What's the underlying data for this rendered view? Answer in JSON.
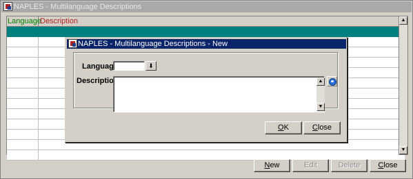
{
  "window": {
    "title": "NAPLES - Multilanguage Descriptions"
  },
  "grid": {
    "columns": [
      "Language",
      "Description"
    ],
    "rows": [
      {
        "language": "",
        "description": ""
      },
      {
        "language": "",
        "description": ""
      },
      {
        "language": "",
        "description": ""
      },
      {
        "language": "",
        "description": ""
      },
      {
        "language": "",
        "description": ""
      },
      {
        "language": "",
        "description": ""
      },
      {
        "language": "",
        "description": ""
      },
      {
        "language": "",
        "description": ""
      },
      {
        "language": "",
        "description": ""
      },
      {
        "language": "",
        "description": ""
      },
      {
        "language": "",
        "description": ""
      },
      {
        "language": "",
        "description": ""
      },
      {
        "language": "",
        "description": ""
      }
    ],
    "selected_row": 0,
    "selected_color": "#008080"
  },
  "buttons": {
    "new": {
      "label": "New",
      "mnemonic": "N",
      "rest": "ew",
      "enabled": true
    },
    "edit": {
      "label": "Edit",
      "enabled": false
    },
    "delete": {
      "label": "Delete",
      "enabled": false
    },
    "close": {
      "label": "Close",
      "mnemonic": "C",
      "rest": "lose",
      "enabled": true
    }
  },
  "dialog": {
    "title": "NAPLES - Multilanguage Descriptions - New",
    "language_label": "Language",
    "language_value": "",
    "description_label": "Description",
    "description_value": "",
    "ok": {
      "label": "OK",
      "mnemonic": "O",
      "rest": "K"
    },
    "close": {
      "label": "Close",
      "mnemonic": "C",
      "rest": "lose"
    }
  },
  "icons": {
    "app": "naples-app-icon",
    "dropdown": "down-arrow-icon",
    "editor": "edit-text-icon"
  }
}
